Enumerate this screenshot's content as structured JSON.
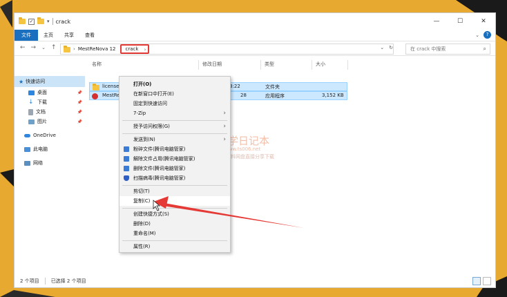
{
  "window": {
    "title": "crack",
    "controls": {
      "minimize": "—",
      "maximize": "☐",
      "close": "✕"
    }
  },
  "ribbon": {
    "tabs": [
      "文件",
      "主页",
      "共享",
      "查看"
    ],
    "expand": "⌄"
  },
  "address": {
    "nav": {
      "back": "←",
      "forward": "→",
      "recent": "⌄",
      "up": "↑"
    },
    "path": [
      "MestReNova 12",
      "crack"
    ],
    "separator": "›",
    "dropdown": "⌄",
    "refresh": "↻"
  },
  "search": {
    "placeholder": "在 crack 中搜索"
  },
  "sidebar": {
    "items": [
      {
        "label": "快速访问"
      },
      {
        "label": "桌面"
      },
      {
        "label": "下载"
      },
      {
        "label": "文档"
      },
      {
        "label": "图片"
      },
      {
        "label": "OneDrive"
      },
      {
        "label": "此电脑"
      },
      {
        "label": "网络"
      }
    ]
  },
  "columns": {
    "name": "名称",
    "modified": "修改日期",
    "type": "类型",
    "size": "大小"
  },
  "files": [
    {
      "name": "licenses",
      "modified": "2024/4/2 23:22",
      "type": "文件夹",
      "size": ""
    },
    {
      "name": "MestRe",
      "modified": "28",
      "type": "应用程序",
      "size": "3,152 KB"
    }
  ],
  "status": {
    "count": "2 个项目",
    "selected": "已选择 2 个项目"
  },
  "context_menu": {
    "items": [
      "打开(O)",
      "在新窗口中打开(E)",
      "固定到快速访问",
      "7-Zip",
      "授予访问权限(G)",
      "发送到(N)",
      "粉碎文件(腾讯电脑管家)",
      "解除文件占用(腾讯电脑管家)",
      "删除文件(腾讯电脑管家)",
      "扫描病毒(腾讯电脑管家)",
      "剪切(T)",
      "复制(C)",
      "创建快捷方式(S)",
      "删除(D)",
      "重命名(M)",
      "属性(R)"
    ]
  },
  "watermark": {
    "title": "同学日记本",
    "url": "www.ts006.net",
    "subtitle": "软件、资源、资料网盘直接分享下载"
  },
  "colors": {
    "accent": "#1A6FBF",
    "highlight": "#E53935",
    "background": "#E8A930"
  }
}
